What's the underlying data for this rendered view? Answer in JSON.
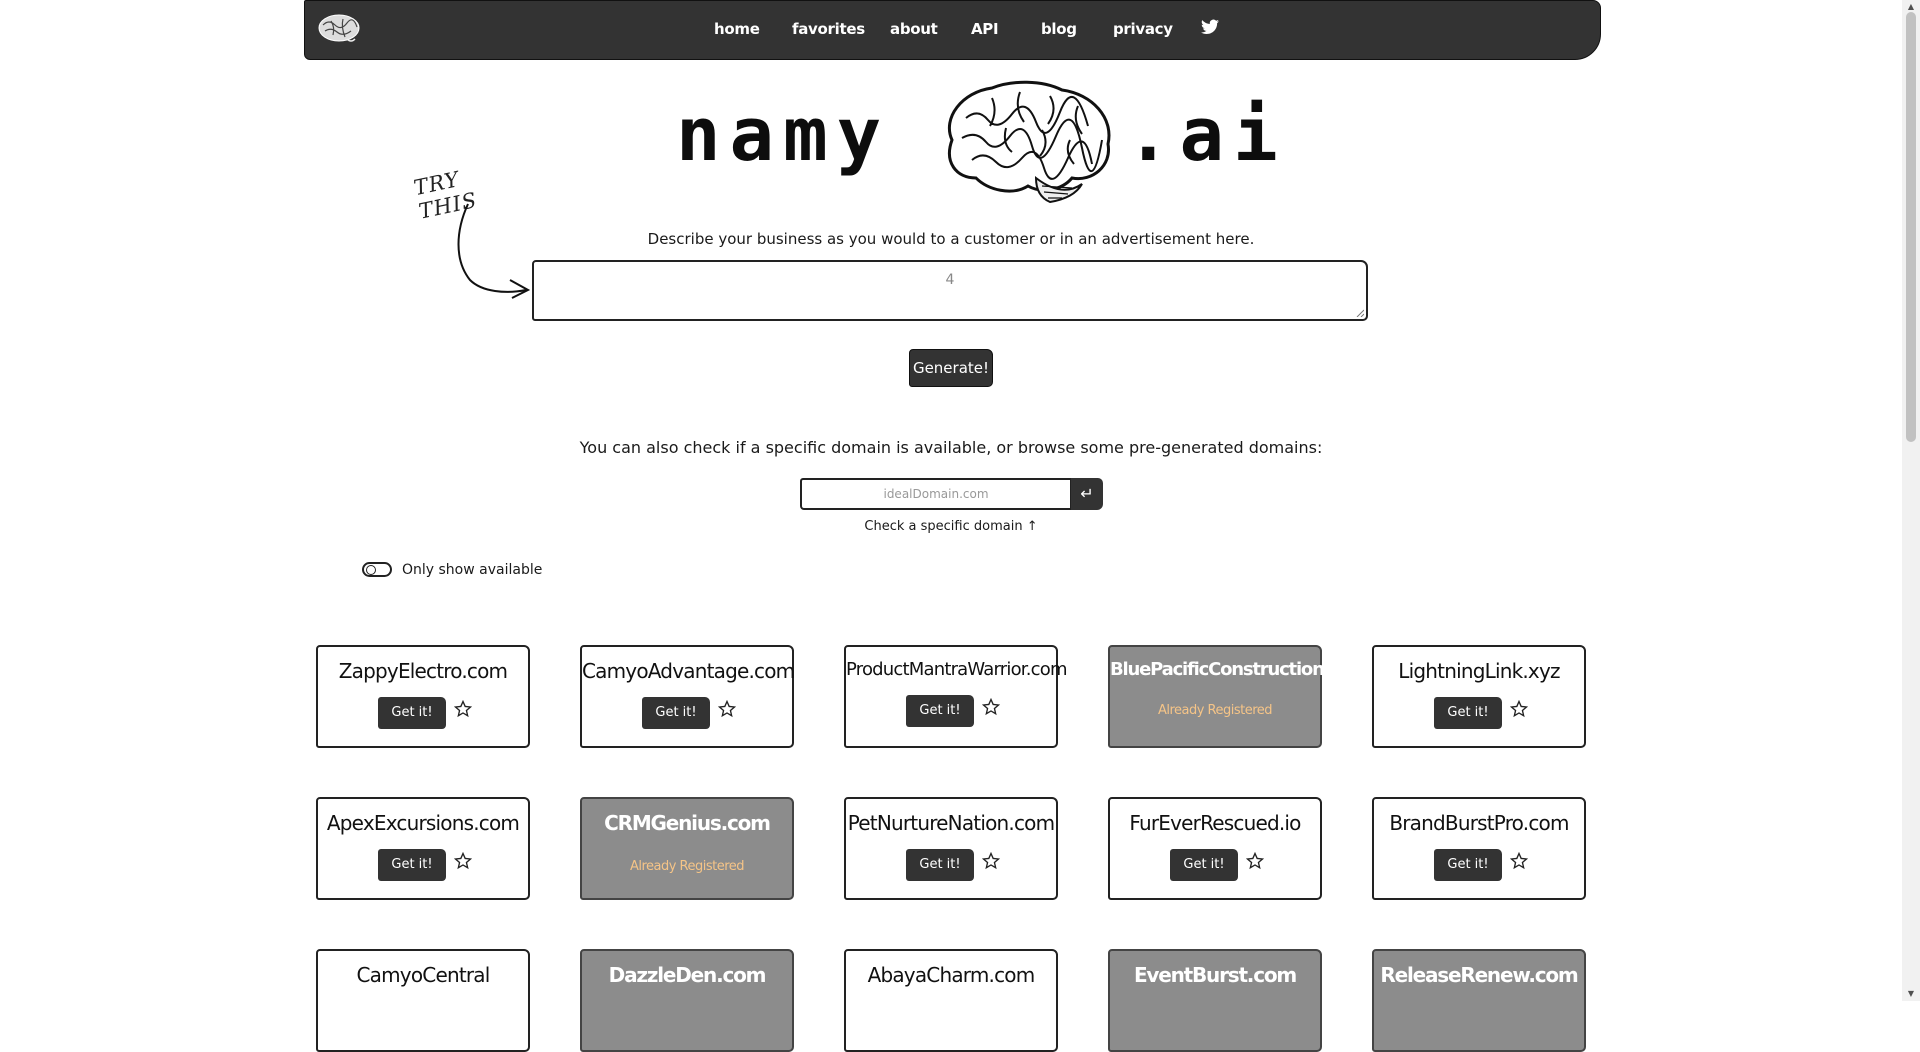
{
  "nav": {
    "items": [
      {
        "label": "home"
      },
      {
        "label": "favorites"
      },
      {
        "label": "about"
      },
      {
        "label": "API"
      },
      {
        "label": "blog"
      },
      {
        "label": "privacy"
      }
    ],
    "twitter_icon": "twitter-bird-icon",
    "logo_icon": "brain-icon"
  },
  "hero": {
    "left_text": "namy",
    "right_text": ".ai"
  },
  "try_this": "TRY THIS",
  "describe_label": "Describe your business as you would to a customer or in an advertisement here.",
  "business_input": {
    "value": "4"
  },
  "generate_label": "Generate!",
  "also_check": "You can also check if a specific domain is available, or browse some pre-generated domains:",
  "domain_input": {
    "placeholder": "idealDomain.com",
    "enter_icon": "enter-arrow-icon"
  },
  "check_caption": "Check a specific domain ↑",
  "toggle_label": "Only show available",
  "get_label": "Get it!",
  "registered_label": "Already Registered",
  "domains": [
    {
      "name": "ZappyElectro.com",
      "status": "available"
    },
    {
      "name": "CamyoAdvantage.com",
      "status": "available"
    },
    {
      "name": "ProductMantraWarrior.com",
      "status": "available"
    },
    {
      "name": "BluePacificConstruction.com",
      "status": "registered"
    },
    {
      "name": "LightningLink.xyz",
      "status": "available"
    },
    {
      "name": "ApexExcursions.com",
      "status": "available"
    },
    {
      "name": "CRMGenius.com",
      "status": "registered"
    },
    {
      "name": "PetNurtureNation.com",
      "status": "available"
    },
    {
      "name": "FurEverRescued.io",
      "status": "available"
    },
    {
      "name": "BrandBurstPro.com",
      "status": "available"
    },
    {
      "name": "CamyoCentral",
      "status": "available"
    },
    {
      "name": "DazzleDen.com",
      "status": "registered"
    },
    {
      "name": "AbayaCharm.com",
      "status": "available"
    },
    {
      "name": "EventBurst.com",
      "status": "registered"
    },
    {
      "name": "ReleaseRenew.com",
      "status": "registered"
    }
  ]
}
